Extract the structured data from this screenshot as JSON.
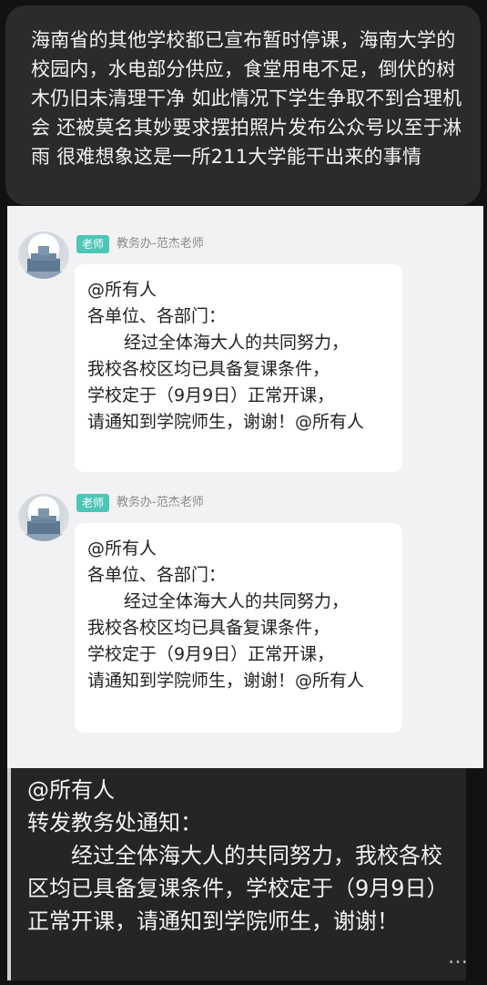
{
  "post": {
    "text": "海南省的其他学校都已宣布暂时停课，海南大学的校园内，水电部分供应，食堂用电不足，倒伏的树木仍旧未清理干净 如此情况下学生争取不到合理机会 还被莫名其妙要求摆拍照片发布公众号以至于淋雨 很难想象这是一所211大学能干出来的事情"
  },
  "chat": {
    "messages": [
      {
        "tag": "老师",
        "sender": "教务办-范杰老师",
        "line1": "@所有人",
        "line2": "各单位、各部门：",
        "line3": "经过全体海大人的共同努力，",
        "line4": "我校各校区均已具备复课条件，",
        "line5": "学校定于（9月9日）正常开课，",
        "line6": "请通知到学院师生，谢谢！@所有人"
      },
      {
        "tag": "老师",
        "sender": "教务办-范杰老师",
        "line1": "@所有人",
        "line2": "各单位、各部门：",
        "line3": "经过全体海大人的共同努力，",
        "line4": "我校各校区均已具备复课条件，",
        "line5": "学校定于（9月9日）正常开课，",
        "line6": "请通知到学院师生，谢谢！@所有人"
      }
    ]
  },
  "notice": {
    "line1": "@所有人",
    "line2": "转发教务处通知：",
    "body": "经过全体海大人的共同努力，我校各校区均已具备复课条件，学校定于（9月9日）正常开课，请通知到学院师生，谢谢！"
  },
  "watermark": "…"
}
